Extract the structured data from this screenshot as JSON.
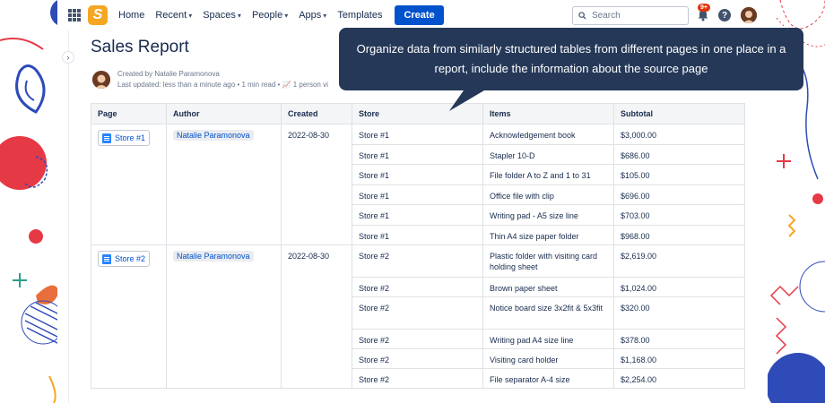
{
  "nav": {
    "items": [
      {
        "label": "Home",
        "dropdown": false
      },
      {
        "label": "Recent",
        "dropdown": true
      },
      {
        "label": "Spaces",
        "dropdown": true
      },
      {
        "label": "People",
        "dropdown": true
      },
      {
        "label": "Apps",
        "dropdown": true
      },
      {
        "label": "Templates",
        "dropdown": false
      }
    ],
    "create_label": "Create",
    "search_placeholder": "Search",
    "notification_badge": "9+",
    "help_label": "?"
  },
  "page": {
    "title": "Sales Report",
    "created_by": "Created by Natalie Paramonova",
    "last_updated": "Last updated: less than a minute ago",
    "read_time": "1 min read",
    "viewers": "1 person vi"
  },
  "tooltip": {
    "text": "Organize data from similarly structured tables from different pages in one place in a report, include the information about the source page"
  },
  "table": {
    "headers": [
      "Page",
      "Author",
      "Created",
      "Store",
      "Items",
      "Subtotal"
    ],
    "groups": [
      {
        "page": "Store #1",
        "author": "Natalie Paramonova",
        "created": "2022-08-30",
        "rows": [
          {
            "store": "Store #1",
            "item": "Acknowledgement book",
            "subtotal": "$3,000.00"
          },
          {
            "store": "Store #1",
            "item": "Stapler 10-D",
            "subtotal": "$686.00"
          },
          {
            "store": "Store #1",
            "item": "File folder A to Z and 1 to 31",
            "subtotal": "$105.00"
          },
          {
            "store": "Store #1",
            "item": "Office file with clip",
            "subtotal": "$696.00"
          },
          {
            "store": "Store #1",
            "item": "Writing pad  - A5 size line",
            "subtotal": "$703.00"
          },
          {
            "store": "Store #1",
            "item": "Thin A4 size paper folder",
            "subtotal": "$968.00"
          }
        ]
      },
      {
        "page": "Store #2",
        "author": "Natalie Paramonova",
        "created": "2022-08-30",
        "rows": [
          {
            "store": "Store #2",
            "item": "Plastic folder with visiting card holding sheet",
            "subtotal": "$2,619.00"
          },
          {
            "store": "Store #2",
            "item": "Brown paper sheet",
            "subtotal": "$1,024.00"
          },
          {
            "store": "Store #2",
            "item": "Notice board size 3x2fit & 5x3fit",
            "subtotal": "$320.00"
          },
          {
            "store": "Store #2",
            "item": "Writing pad A4 size line",
            "subtotal": "$378.00"
          },
          {
            "store": "Store #2",
            "item": "Visiting card holder",
            "subtotal": "$1,168.00"
          },
          {
            "store": "Store #2",
            "item": "File separator A-4 size",
            "subtotal": "$2,254.00"
          }
        ]
      }
    ]
  },
  "colors": {
    "brand": "#0052cc",
    "tooltip_bg": "#253858",
    "logo": "#f5a623",
    "badge": "#de350b"
  }
}
